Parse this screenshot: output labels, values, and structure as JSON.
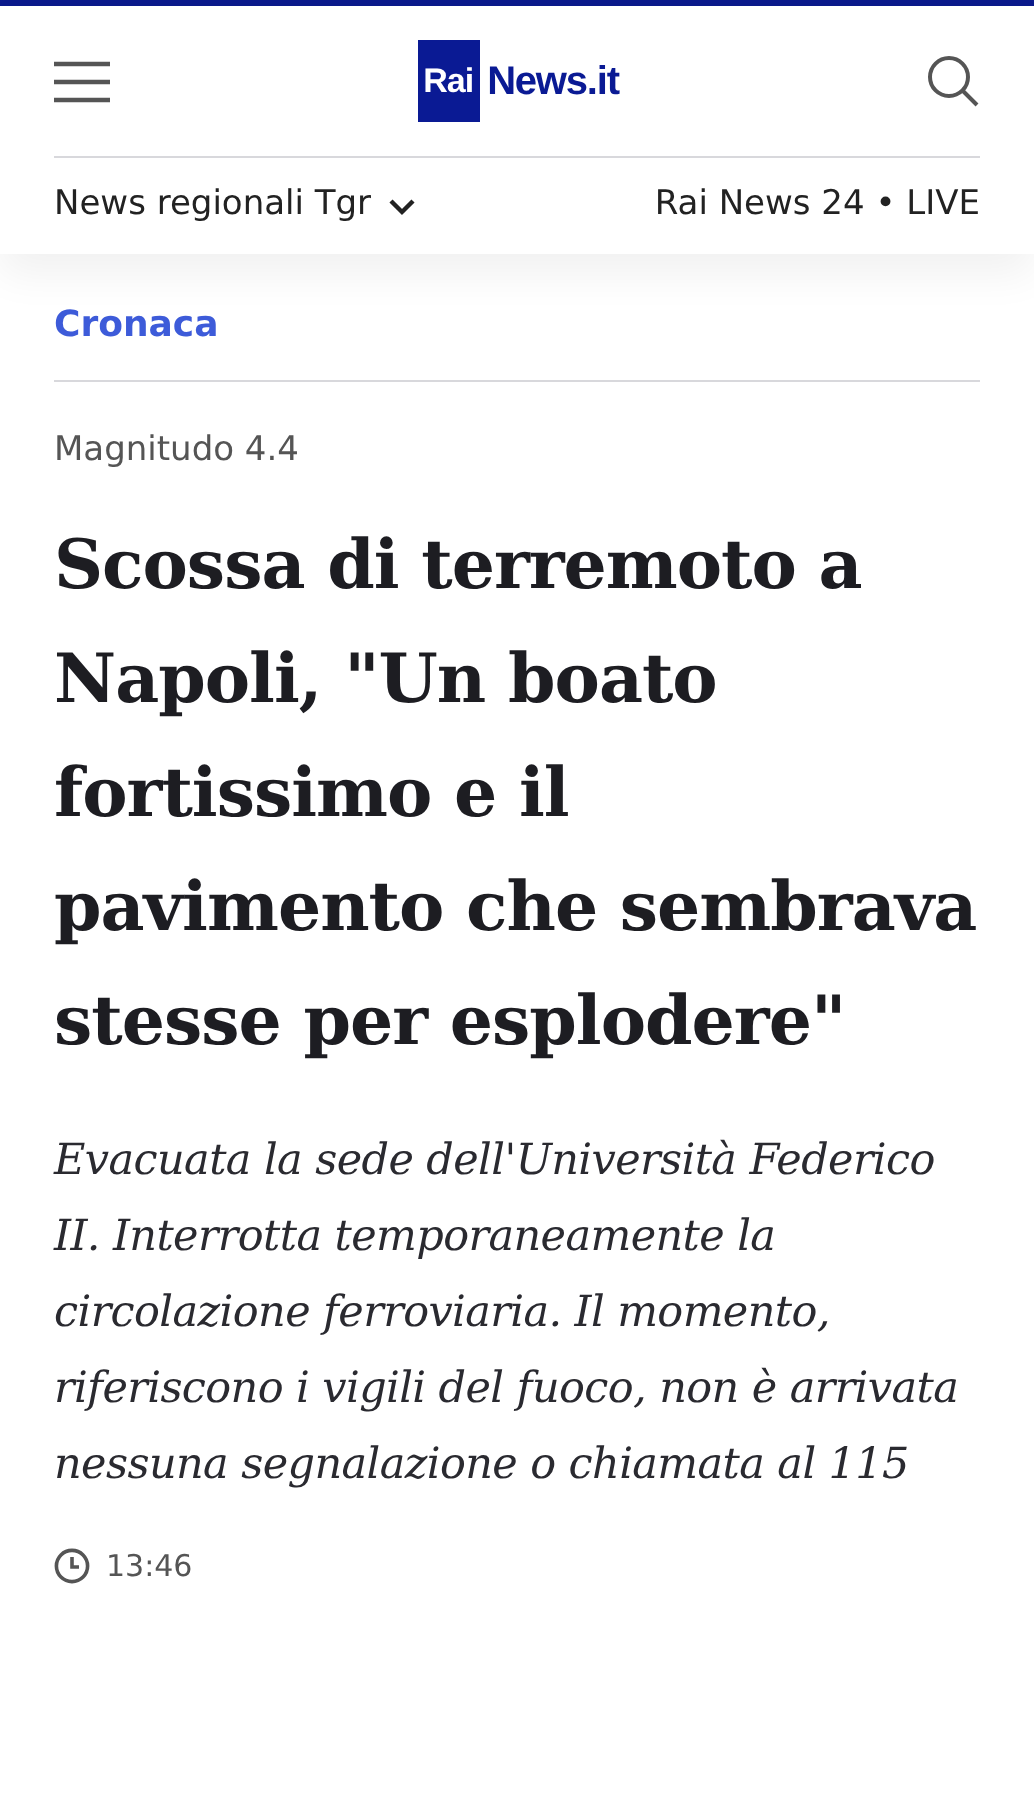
{
  "header": {
    "logo": {
      "box": "Rai",
      "text": "News.it"
    },
    "regional_menu": "News regionali Tgr",
    "live_link": "Rai News 24 • LIVE"
  },
  "article": {
    "section": "Cronaca",
    "kicker": "Magnitudo 4.4",
    "title": "Scossa di terremoto a Napoli, \"Un boato fortissimo e il pavimento che sembrava stesse per esplodere\"",
    "summary": "Evacuata la sede dell'Università Federico II. Interrotta temporaneamente la circolazione ferroviaria. Il momento, riferiscono i vigili del fuoco, non è arrivata nessuna segnalazione o chiamata al 115",
    "time": "13:46"
  }
}
